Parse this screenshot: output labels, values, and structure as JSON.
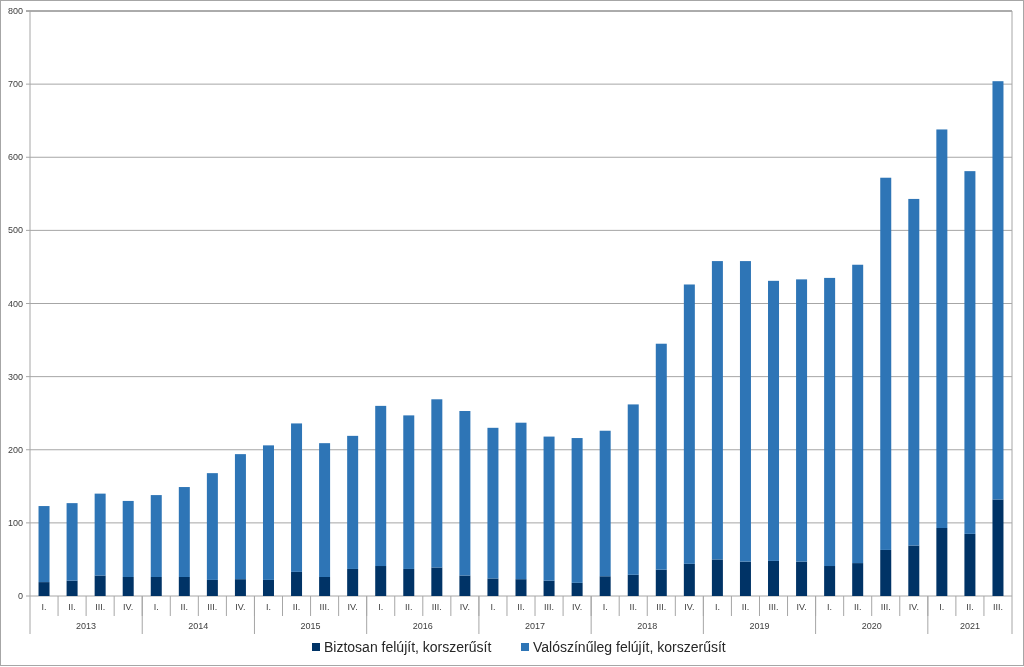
{
  "year_axis": {
    "labels": [
      "2013",
      "2014",
      "2015",
      "2016",
      "2017",
      "2018",
      "2019",
      "2020",
      "2021"
    ]
  },
  "chart_data": {
    "type": "bar",
    "stacked": true,
    "orientation": "vertical",
    "ylim": [
      0,
      800
    ],
    "yticks": [
      0,
      100,
      200,
      300,
      400,
      500,
      600,
      700,
      800
    ],
    "categories": [
      "I.",
      "II.",
      "III.",
      "IV.",
      "I.",
      "II.",
      "III.",
      "IV.",
      "I.",
      "II.",
      "III.",
      "IV.",
      "I.",
      "II.",
      "III.",
      "IV.",
      "I.",
      "II.",
      "III.",
      "IV.",
      "I.",
      "II.",
      "III.",
      "IV.",
      "I.",
      "II.",
      "III.",
      "IV.",
      "I.",
      "II.",
      "III.",
      "IV.",
      "I.",
      "II.",
      "III."
    ],
    "grid": true,
    "legend": true,
    "series": [
      {
        "name": "Biztosan felújít, korszerűsít",
        "color": "#003366",
        "values": [
          19,
          21,
          28,
          26,
          26,
          26,
          22,
          23,
          22,
          33,
          26,
          37,
          41,
          37,
          39,
          28,
          24,
          23,
          21,
          18,
          27,
          29,
          36,
          44,
          50,
          47,
          48,
          47,
          41,
          45,
          63,
          69,
          93,
          85,
          132
        ]
      },
      {
        "name": "Valószínűleg felújít, korszerűsít",
        "color": "#2e75b6",
        "values": [
          104,
          106,
          112,
          104,
          112,
          123,
          146,
          171,
          184,
          203,
          183,
          182,
          219,
          210,
          230,
          225,
          206,
          214,
          197,
          198,
          199,
          233,
          309,
          382,
          408,
          411,
          383,
          386,
          394,
          408,
          509,
          474,
          545,
          496,
          572
        ]
      }
    ]
  }
}
